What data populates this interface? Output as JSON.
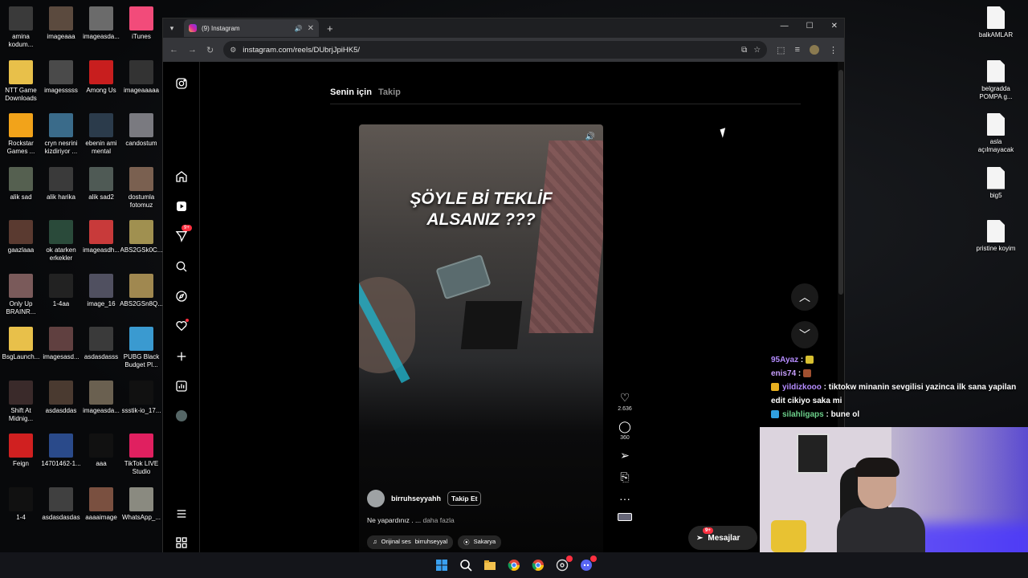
{
  "desktop": {
    "left_icons": [
      {
        "label": "amina kodum...",
        "color": "#3a3a3a"
      },
      {
        "label": "imageaaa",
        "color": "#5b4a3e"
      },
      {
        "label": "imageasda...",
        "color": "#6b6b6b"
      },
      {
        "label": "iTunes",
        "color": "#f24b7a"
      },
      {
        "label": "NTT Game Downloads",
        "color": "#e8c04a"
      },
      {
        "label": "imagesssss",
        "color": "#4a4a4a"
      },
      {
        "label": "Among Us",
        "color": "#c81e1e"
      },
      {
        "label": "imageaaaaa",
        "color": "#333"
      },
      {
        "label": "Rockstar Games ...",
        "color": "#f2a31a"
      },
      {
        "label": "cryn nesrini kizdiriyor ...",
        "color": "#3a6b8a"
      },
      {
        "label": "ebenin ami mental",
        "color": "#2b3b4b"
      },
      {
        "label": "candostum",
        "color": "#7a7a80"
      },
      {
        "label": "alik sad",
        "color": "#556050"
      },
      {
        "label": "alik harika",
        "color": "#3a3a3a"
      },
      {
        "label": "alik sad2",
        "color": "#4f5a55"
      },
      {
        "label": "dostumla fotomuz",
        "color": "#7a6050"
      },
      {
        "label": "gaazlaaa",
        "color": "#5a3a30"
      },
      {
        "label": "ok atarken erkekler",
        "color": "#2a4a3a"
      },
      {
        "label": "imageasdh...",
        "color": "#c83a3a"
      },
      {
        "label": "ABS2GSk0C...",
        "color": "#a09050"
      },
      {
        "label": "Only Up BRAINR...",
        "color": "#7a5a5a"
      },
      {
        "label": "1-4aa",
        "color": "#222"
      },
      {
        "label": "image_16",
        "color": "#505060"
      },
      {
        "label": "ABS2GSn8Q...",
        "color": "#a08850"
      },
      {
        "label": "BsgLaunch...",
        "color": "#e8c04a"
      },
      {
        "label": "imagesasd...",
        "color": "#604040"
      },
      {
        "label": "asdasdasss",
        "color": "#3a3a3a"
      },
      {
        "label": "PUBG Black Budget Pl...",
        "color": "#3a9ad0"
      },
      {
        "label": "Shift At Midnig...",
        "color": "#3a2a2a"
      },
      {
        "label": "asdasddas",
        "color": "#4a3a30"
      },
      {
        "label": "imageasda...",
        "color": "#6a6050"
      },
      {
        "label": "ssstik-io_17...",
        "color": "#111"
      },
      {
        "label": "Feign",
        "color": "#d02020"
      },
      {
        "label": "14701462-1...",
        "color": "#2a4a8a"
      },
      {
        "label": "aaa",
        "color": "#111"
      },
      {
        "label": "TikTok LIVE Studio",
        "color": "#e02060"
      },
      {
        "label": "1-4",
        "color": "#111"
      },
      {
        "label": "asdasdasdas",
        "color": "#404040"
      },
      {
        "label": "aaaaimage",
        "color": "#7a5040"
      },
      {
        "label": "WhatsApp_...",
        "color": "#8a8a80"
      }
    ],
    "right_icons": [
      {
        "label": "balkAMLAR"
      },
      {
        "label": "belgradda POMPA g..."
      },
      {
        "label": "asla açılmayacak"
      },
      {
        "label": "big5"
      },
      {
        "label": "pristine koyim"
      }
    ]
  },
  "browser": {
    "tab_title": "(9) Instagram",
    "url": "instagram.com/reels/DUbrjJpiHK5/"
  },
  "instagram": {
    "feed_tabs": {
      "active": "Senin için",
      "inactive": "Takip"
    },
    "nav_badge": "9+",
    "reel": {
      "caption_line1": "ŞÖYLE Bİ TEKLİF",
      "caption_line2": "ALSANIZ ???",
      "username": "birruhseyyahh",
      "follow_label": "Takip Et",
      "description": "Ne yapardınız . ...",
      "more_label": "daha fazla",
      "audio": "Orijinal ses",
      "audio_user": "birruhseyyal",
      "location": "Sakarya"
    },
    "actions": {
      "likes": "2.636",
      "comments": "360"
    },
    "messages_label": "Mesajlar",
    "messages_badge": "9+"
  },
  "chat": [
    {
      "user": "95Ayaz",
      "text": "",
      "emote_color": "#d8c030"
    },
    {
      "user": "enis74",
      "text": "",
      "emote_color": "#a05030"
    },
    {
      "user": "yildizkooo",
      "text": "tiktokw minanin sevgilisi yazinca ilk sana yapilan edit cikiyo saka mi",
      "emote_color": "#e8b020"
    },
    {
      "user": "silahligaps",
      "text": "bune ol",
      "emote_color": "#30a0e0"
    }
  ]
}
